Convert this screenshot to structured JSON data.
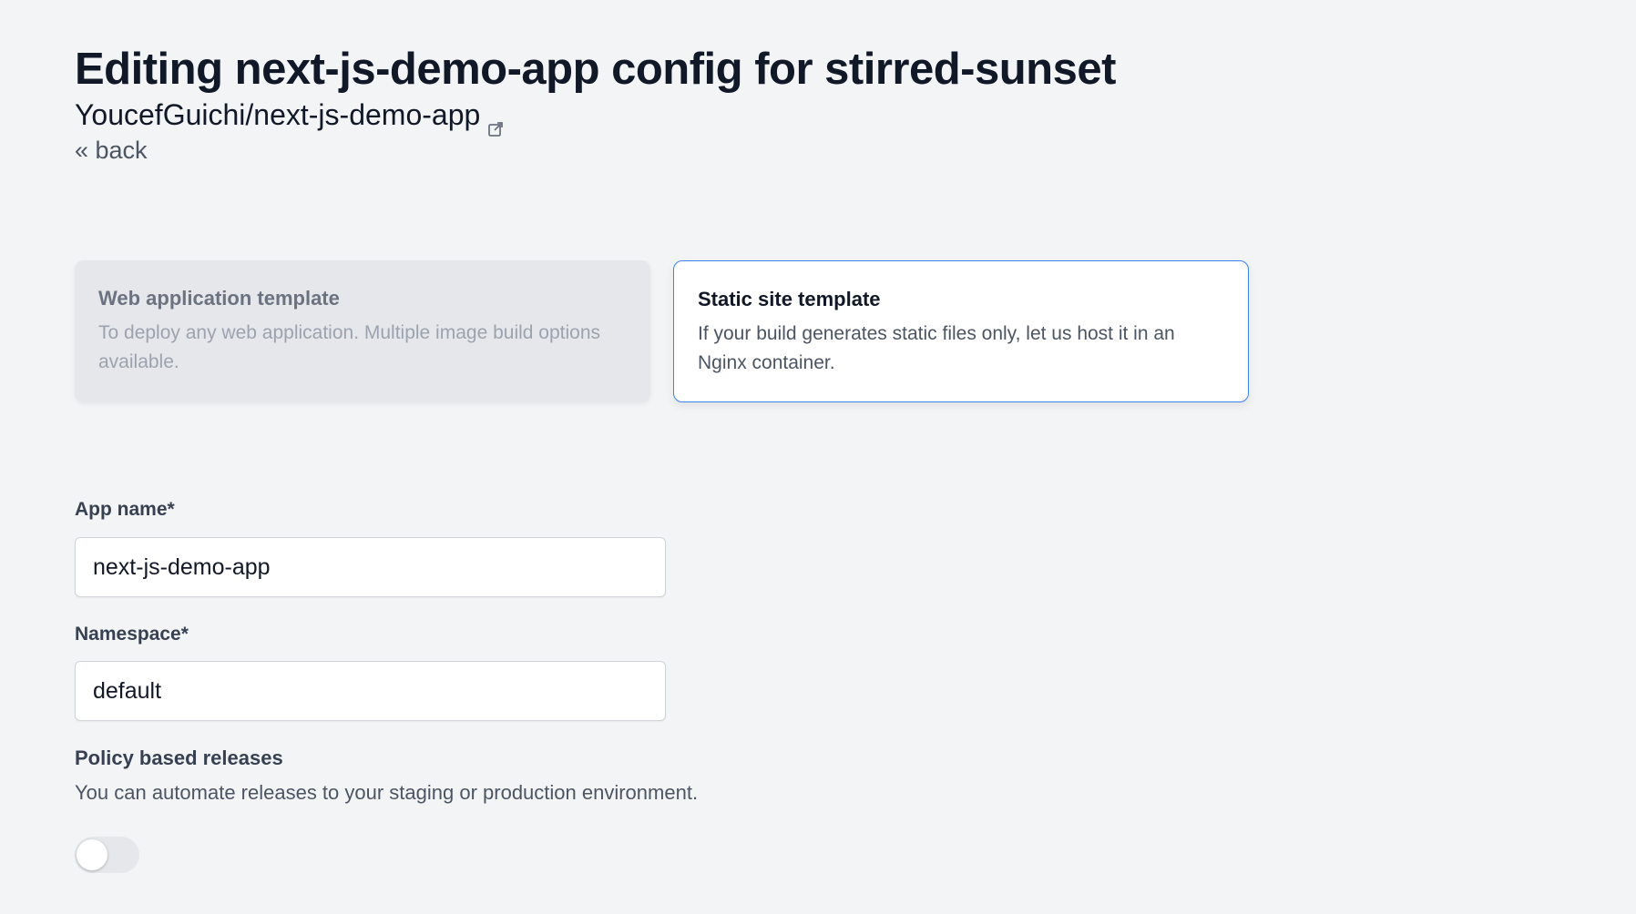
{
  "header": {
    "title": "Editing next-js-demo-app config for stirred-sunset",
    "repo": "YoucefGuichi/next-js-demo-app",
    "repo_icon": "external-link-icon",
    "back_label": "« back"
  },
  "templates": [
    {
      "title": "Web application template",
      "description": "To deploy any web application. Multiple image build options available.",
      "state": "disabled"
    },
    {
      "title": "Static site template",
      "description": "If your build generates static files only, let us host it in an Nginx container.",
      "state": "selected"
    }
  ],
  "form": {
    "app_name": {
      "label": "App name*",
      "value": "next-js-demo-app"
    },
    "namespace": {
      "label": "Namespace*",
      "value": "default"
    },
    "policy": {
      "title": "Policy based releases",
      "description": "You can automate releases to your staging or production environment.",
      "enabled": false
    }
  },
  "colors": {
    "background": "#f3f4f6",
    "accent": "#3b82f6",
    "text": "#111827"
  }
}
